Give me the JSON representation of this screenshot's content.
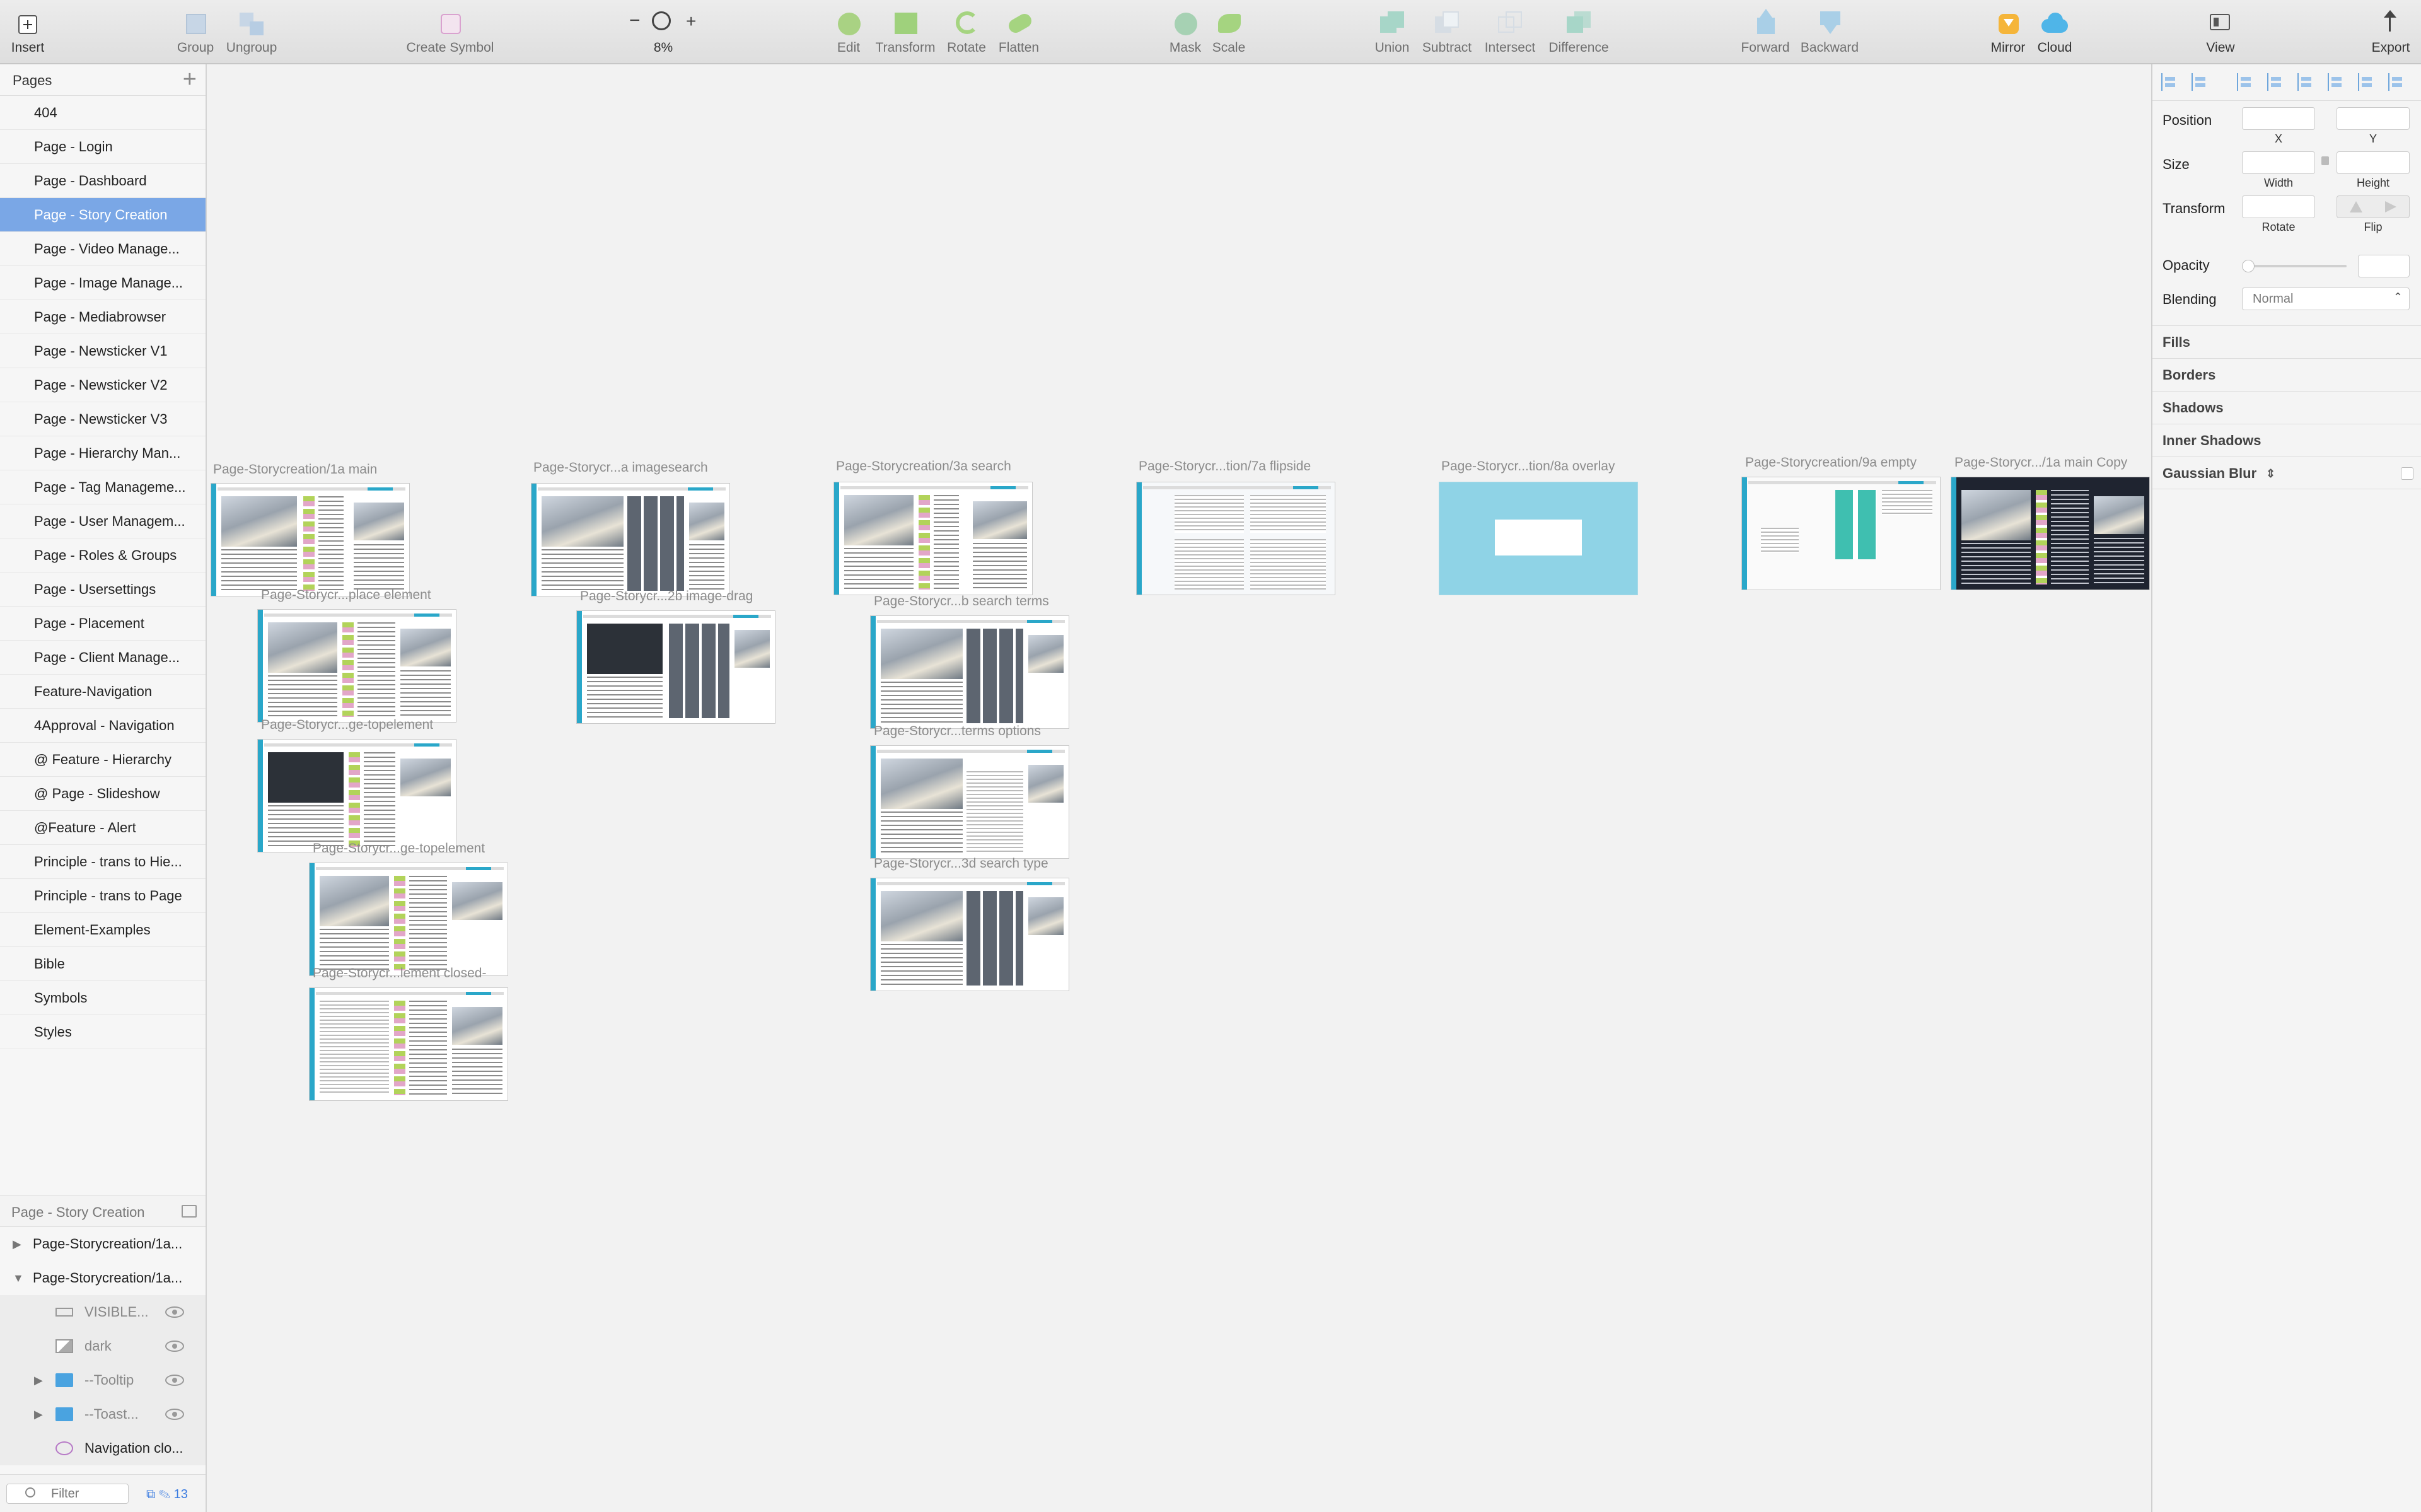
{
  "toolbar": {
    "insert": "Insert",
    "group": "Group",
    "ungroup": "Ungroup",
    "create_symbol": "Create Symbol",
    "zoom_value": "8%",
    "edit": "Edit",
    "transform": "Transform",
    "rotate": "Rotate",
    "flatten": "Flatten",
    "mask": "Mask",
    "scale": "Scale",
    "union": "Union",
    "subtract": "Subtract",
    "intersect": "Intersect",
    "difference": "Difference",
    "forward": "Forward",
    "backward": "Backward",
    "mirror": "Mirror",
    "cloud": "Cloud",
    "view": "View",
    "export": "Export"
  },
  "pages": {
    "title": "Pages",
    "items": [
      "404",
      "Page - Login",
      "Page - Dashboard",
      "Page - Story Creation",
      "Page - Video Manage...",
      "Page - Image Manage...",
      "Page - Mediabrowser",
      "Page - Newsticker V1",
      "Page - Newsticker V2",
      "Page - Newsticker V3",
      "Page - Hierarchy Man...",
      "Page - Tag Manageme...",
      "Page - User Managem...",
      "Page - Roles & Groups",
      "Page - Usersettings",
      "Page - Placement",
      "Page - Client Manage...",
      "Feature-Navigation",
      "4Approval - Navigation",
      "@ Feature - Hierarchy",
      "@ Page - Slideshow",
      "@Feature - Alert",
      "Principle - trans to Hie...",
      "Principle - trans to Page",
      "Element-Examples",
      "Bible",
      "Symbols",
      "Styles"
    ],
    "selected": "Page - Story Creation"
  },
  "layers": {
    "current_page": "Page - Story Creation",
    "rows": [
      {
        "name": "Page-Storycreation/1a...",
        "expanded": false
      },
      {
        "name": "Page-Storycreation/1a...",
        "expanded": true
      },
      {
        "name": "VISIBLE...",
        "icon": "rectangle-icon"
      },
      {
        "name": "dark",
        "icon": "image-icon"
      },
      {
        "name": "--Tooltip",
        "icon": "folder-icon"
      },
      {
        "name": "--Toast...",
        "icon": "folder-icon"
      },
      {
        "name": "Navigation clo...",
        "icon": "symbol-icon"
      }
    ],
    "filter_placeholder": "Filter",
    "count": "13"
  },
  "artboards": [
    "Page-Storycreation/1a main",
    "Page-Storycr...a imagesearch",
    "Page-Storycreation/3a search",
    "Page-Storycr...tion/7a flipside",
    "Page-Storycr...tion/8a overlay",
    "Page-Storycreation/9a empty",
    "Page-Storycr.../1a main Copy",
    "Page-Storycr...place element",
    "Page-Storycr...2b image-drag",
    "Page-Storycr...b search terms",
    "Page-Storycr...ge-topelement",
    "Page-Storycr...terms options",
    "Page-Storycr...ge-topelement",
    "Page-Storycr...3d search type",
    "Page-Storycr...lement closed-"
  ],
  "inspector": {
    "position": "Position",
    "x": "X",
    "y": "Y",
    "size": "Size",
    "width": "Width",
    "height": "Height",
    "transform": "Transform",
    "rotate": "Rotate",
    "flip": "Flip",
    "opacity": "Opacity",
    "blending": "Blending",
    "blending_value": "Normal",
    "fills": "Fills",
    "borders": "Borders",
    "shadows": "Shadows",
    "inner_shadows": "Inner Shadows",
    "gaussian_blur": "Gaussian Blur"
  },
  "colors": {
    "selection": "#7aa7e6",
    "accent": "#2aa7c9",
    "overlay": "#8fd3e6"
  }
}
